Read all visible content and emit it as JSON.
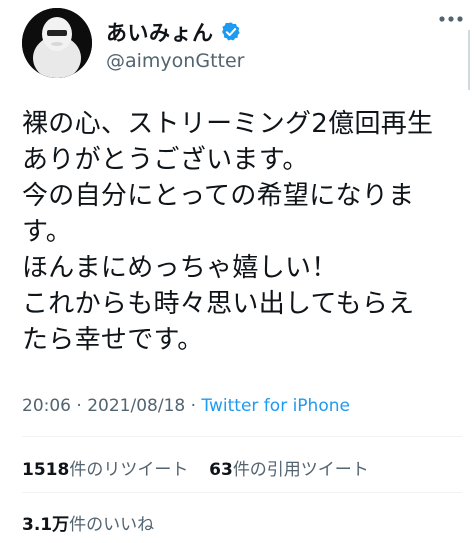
{
  "author": {
    "display_name": "あいみょん",
    "handle": "@aimyonGtter",
    "verified": true
  },
  "tweet": {
    "text": "裸の心、ストリーミング2億回再生\nありがとうございます。\n今の自分にとっての希望になりま\nす。\nほんまにめっちゃ嬉しい！\nこれからも時々思い出してもらえ\nたら幸せです。",
    "time": "20:06",
    "separator1": " · ",
    "date": "2021/08/18",
    "separator2": " · ",
    "source": "Twitter for iPhone"
  },
  "stats": {
    "retweets_count": "1518",
    "retweets_label": "件のリツイート",
    "quotes_count": "63",
    "quotes_label": "件の引用ツイート",
    "likes_count": "3.1万",
    "likes_label": "件のいいね"
  },
  "colors": {
    "text": "#0f1419",
    "secondary": "#536471",
    "accent": "#1d9bf0"
  },
  "icons": {
    "verified": "verified-badge-icon",
    "more": "more-options-icon"
  }
}
